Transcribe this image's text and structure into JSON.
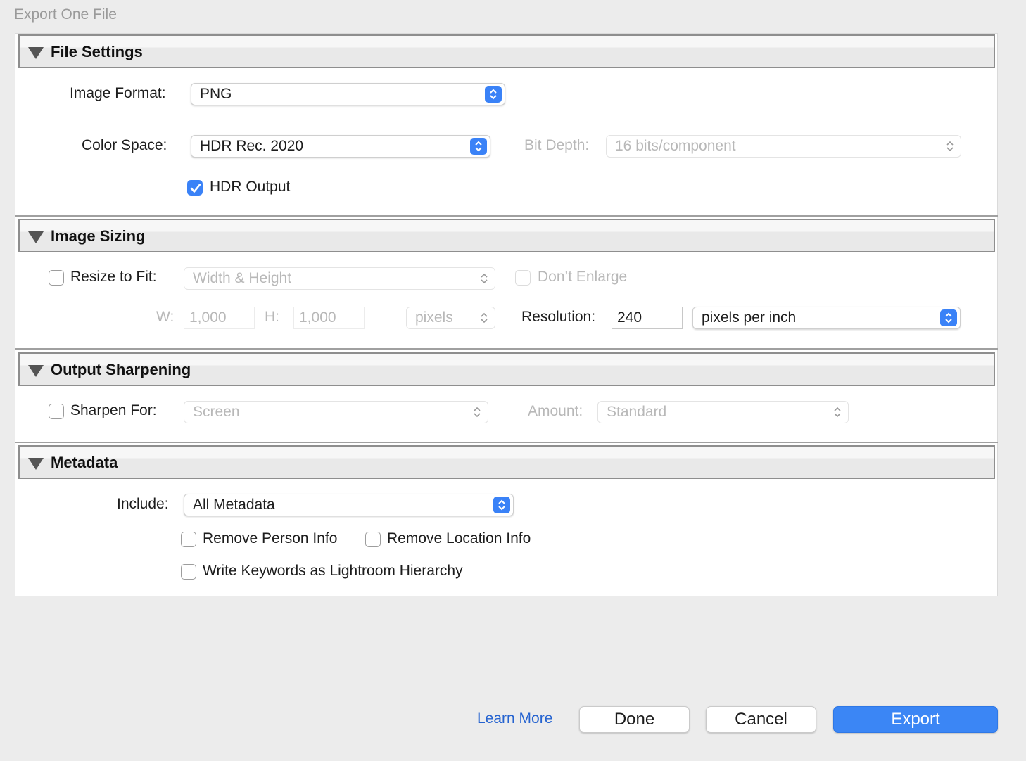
{
  "window": {
    "title": "Export One File"
  },
  "sections": {
    "file_settings": {
      "title": "File Settings",
      "image_format_label": "Image Format:",
      "image_format_value": "PNG",
      "color_space_label": "Color Space:",
      "color_space_value": "HDR Rec. 2020",
      "bit_depth_label": "Bit Depth:",
      "bit_depth_value": "16 bits/component",
      "hdr_output_label": "HDR Output",
      "hdr_output_checked": true
    },
    "image_sizing": {
      "title": "Image Sizing",
      "resize_label": "Resize to Fit:",
      "resize_checked": false,
      "resize_mode": "Width & Height",
      "dont_enlarge_label": "Don’t Enlarge",
      "w_label": "W:",
      "w_value": "1,000",
      "h_label": "H:",
      "h_value": "1,000",
      "units": "pixels",
      "resolution_label": "Resolution:",
      "resolution_value": "240",
      "resolution_units": "pixels per inch"
    },
    "output_sharpening": {
      "title": "Output Sharpening",
      "sharpen_label": "Sharpen For:",
      "sharpen_checked": false,
      "sharpen_value": "Screen",
      "amount_label": "Amount:",
      "amount_value": "Standard"
    },
    "metadata": {
      "title": "Metadata",
      "include_label": "Include:",
      "include_value": "All Metadata",
      "remove_person_label": "Remove Person Info",
      "remove_location_label": "Remove Location Info",
      "write_keywords_label": "Write Keywords as Lightroom Hierarchy"
    }
  },
  "footer": {
    "learn_more": "Learn More",
    "done": "Done",
    "cancel": "Cancel",
    "export": "Export"
  },
  "colors": {
    "accent": "#3a82f7",
    "link": "#2563d0"
  }
}
